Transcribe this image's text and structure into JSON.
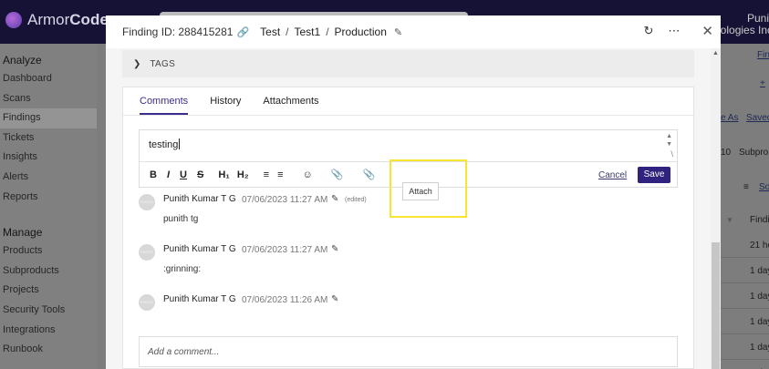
{
  "app": {
    "logo_text_light": "Armor",
    "logo_text_bold": "Code",
    "user_name": "Puni",
    "user_org": "nologies Inc."
  },
  "sidebar": {
    "sections": [
      {
        "title": "Analyze",
        "items": [
          "Dashboard",
          "Scans",
          "Findings",
          "Tickets",
          "Insights",
          "Alerts",
          "Reports"
        ]
      },
      {
        "title": "Manage",
        "items": [
          "Products",
          "Subproducts",
          "Projects",
          "Security Tools",
          "Integrations",
          "Runbook"
        ]
      }
    ],
    "active_item": "Findings"
  },
  "background_right": {
    "link_top": "Fin",
    "plus_link": "+ ",
    "save_as": "e As",
    "saved": "Savec",
    "count": "10",
    "subpro": "Subpro",
    "sort_link": "So",
    "col_header": "Findi",
    "rows": [
      "21 ho",
      "1 day",
      "1 day",
      "1 day",
      "1 day",
      "1 day"
    ]
  },
  "modal": {
    "finding_id_label": "Finding ID: 288415281",
    "breadcrumbs": [
      "Test",
      "Test1",
      "Production"
    ],
    "tags_label": "TAGS",
    "tabs": [
      "Comments",
      "History",
      "Attachments"
    ],
    "active_tab": "Comments",
    "editor": {
      "value": "testing",
      "toolbar": {
        "bold": "B",
        "italic": "I",
        "underline": "U",
        "strike": "S",
        "h1": "H₁",
        "h2": "H₂",
        "ordered_list": "☰",
        "bullet_list": "☰",
        "emoji": "☺",
        "link": "♀",
        "attach": "♀"
      },
      "cancel_label": "Cancel",
      "save_label": "Save",
      "tooltip": "Attach"
    },
    "comments": [
      {
        "avatar": "PHOTO",
        "author": "Punith Kumar T G",
        "time": "07/06/2023 11:27 AM",
        "edited": "(edited)",
        "body": "punith tg"
      },
      {
        "avatar": "PHOTO",
        "author": "Punith Kumar T G",
        "time": "07/06/2023 11:27 AM",
        "edited": "",
        "body": ":grinning:"
      },
      {
        "avatar": "PHOTO",
        "author": "Punith Kumar T G",
        "time": "07/06/2023 11:26 AM",
        "edited": "",
        "body": ""
      }
    ],
    "add_comment_placeholder": "Add a comment..."
  },
  "colors": {
    "accent": "#2f237f",
    "highlight": "#f6e633",
    "topbar": "#161235"
  }
}
